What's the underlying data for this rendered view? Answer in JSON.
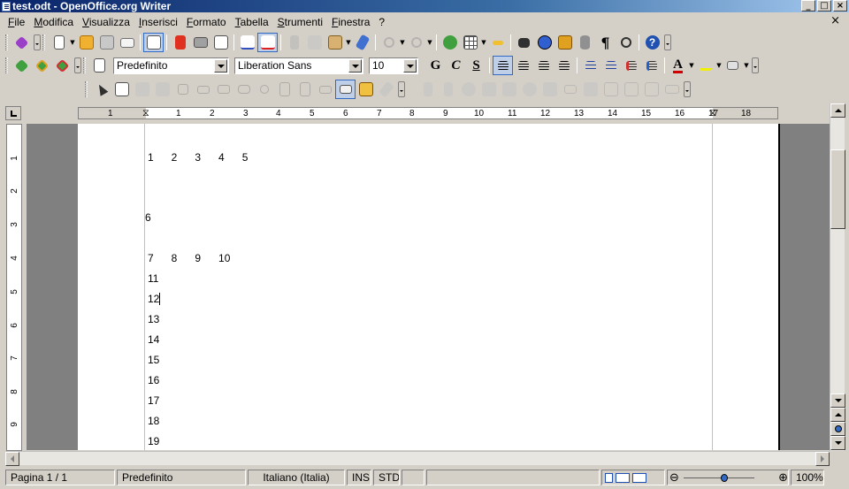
{
  "window": {
    "title": "test.odt - OpenOffice.org Writer",
    "minimize": "_",
    "maximize": "□",
    "close": "×",
    "doc_close": "×"
  },
  "menu": [
    "File",
    "Modifica",
    "Visualizza",
    "Inserisci",
    "Formato",
    "Tabella",
    "Strumenti",
    "Finestra",
    "?"
  ],
  "toolbar_format": {
    "paragraph_style": "Predefinito",
    "font_name": "Liberation Sans",
    "font_size": "10",
    "bold": "G",
    "italic": "C",
    "underline": "S",
    "font_color_letter": "A"
  },
  "ruler": {
    "numbers": [
      "1",
      "1",
      "2",
      "3",
      "4",
      "5",
      "6",
      "7",
      "8",
      "9",
      "10",
      "11",
      "12",
      "13",
      "14",
      "15",
      "16",
      "17",
      "18"
    ],
    "vertical_numbers": [
      "1",
      "2",
      "3",
      "4",
      "5",
      "6",
      "7",
      "8",
      "9"
    ]
  },
  "document": {
    "line1": "1      2      3      4      5",
    "line2": "6",
    "line3": "7      8      9      10",
    "line11": "11",
    "line12": "12",
    "lines_rest": [
      "13",
      "14",
      "15",
      "16",
      "17",
      "18",
      "19"
    ]
  },
  "status": {
    "page": "Pagina 1 / 1",
    "style": "Predefinito",
    "language": "Italiano (Italia)",
    "insert_mode": "INS",
    "selection_mode": "STD",
    "zoom": "100%",
    "zoom_level": 1.0
  },
  "colors": {
    "title_start": "#0a246a",
    "title_end": "#a6caf0",
    "chrome": "#d4d0c8",
    "accent": "#316ac5"
  }
}
